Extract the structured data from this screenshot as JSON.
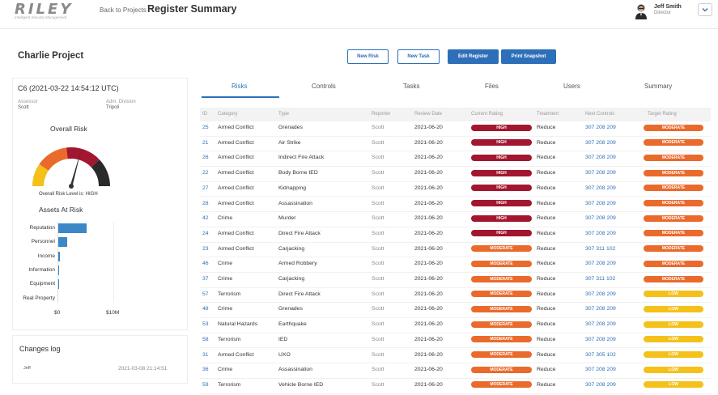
{
  "header": {
    "logo_text": "RILEY",
    "logo_sub": "Intelligent Security Management",
    "back_label": "Back to Projects",
    "title": "Register Summary",
    "user_name": "Jeff Smith",
    "user_role": "Director"
  },
  "project": {
    "name": "Charlie Project",
    "buttons": {
      "new_risk": "New Risk",
      "new_task": "New Task",
      "edit_register": "Edit Register",
      "print_snapshot": "Print Snapshot"
    }
  },
  "risk_panel": {
    "risk_id": "C6 (2021-03-22 14:54:12 UTC)",
    "assessor_label": "Assessor",
    "assessor_value": "Scott",
    "division_label": "Adm. Division",
    "division_value": "Tripoli",
    "overall_title": "Overall Risk",
    "overall_caption": "Overall Risk Level is: HIGH",
    "assets_title": "Assets At Risk",
    "assets": [
      {
        "label": "Reputation",
        "value": 0.52
      },
      {
        "label": "Personnel",
        "value": 0.16
      },
      {
        "label": "Income",
        "value": 0.03
      },
      {
        "label": "Information",
        "value": 0.02
      },
      {
        "label": "Equipment",
        "value": 0.02
      },
      {
        "label": "Real Property",
        "value": 0.0
      }
    ],
    "axis_ticks": [
      "$0",
      "$10M"
    ]
  },
  "changes": {
    "title": "Changes log",
    "user": "Jeff",
    "time": "2021-03-08 21:14:51"
  },
  "tabs": [
    "Risks",
    "Controls",
    "Tasks",
    "Files",
    "Users",
    "Summary"
  ],
  "table": {
    "headers": [
      "ID",
      "Category",
      "Type",
      "Reporter",
      "Review Date",
      "Current Rating",
      "Treatment",
      "Next Controls",
      "Target Rating"
    ],
    "rows": [
      {
        "id": "25",
        "category": "Armed Conflict",
        "type": "Grenades",
        "reporter": "Scott",
        "date": "2021-06-20",
        "current": "HIGH",
        "treatment": "Reduce",
        "controls": "307 208 209",
        "target": "MODERATE"
      },
      {
        "id": "21",
        "category": "Armed Conflict",
        "type": "Air Strike",
        "reporter": "Scott",
        "date": "2021-06-20",
        "current": "HIGH",
        "treatment": "Reduce",
        "controls": "307 208 209",
        "target": "MODERATE"
      },
      {
        "id": "26",
        "category": "Armed Conflict",
        "type": "Indirect Fire Attack",
        "reporter": "Scott",
        "date": "2021-06-20",
        "current": "HIGH",
        "treatment": "Reduce",
        "controls": "307 208 209",
        "target": "MODERATE"
      },
      {
        "id": "22",
        "category": "Armed Conflict",
        "type": "Body Borne IED",
        "reporter": "Scott",
        "date": "2021-06-20",
        "current": "HIGH",
        "treatment": "Reduce",
        "controls": "307 208 209",
        "target": "MODERATE"
      },
      {
        "id": "27",
        "category": "Armed Conflict",
        "type": "Kidnapping",
        "reporter": "Scott",
        "date": "2021-06-20",
        "current": "HIGH",
        "treatment": "Reduce",
        "controls": "307 208 209",
        "target": "MODERATE"
      },
      {
        "id": "28",
        "category": "Armed Conflict",
        "type": "Assassination",
        "reporter": "Scott",
        "date": "2021-06-20",
        "current": "HIGH",
        "treatment": "Reduce",
        "controls": "307 208 209",
        "target": "MODERATE"
      },
      {
        "id": "42",
        "category": "Crime",
        "type": "Murder",
        "reporter": "Scott",
        "date": "2021-06-20",
        "current": "HIGH",
        "treatment": "Reduce",
        "controls": "307 208 209",
        "target": "MODERATE"
      },
      {
        "id": "24",
        "category": "Armed Conflict",
        "type": "Direct Fire Attack",
        "reporter": "Scott",
        "date": "2021-06-20",
        "current": "HIGH",
        "treatment": "Reduce",
        "controls": "307 208 209",
        "target": "MODERATE"
      },
      {
        "id": "23",
        "category": "Armed Conflict",
        "type": "Carjacking",
        "reporter": "Scott",
        "date": "2021-06-20",
        "current": "MODERATE",
        "treatment": "Reduce",
        "controls": "307 311 102",
        "target": "MODERATE"
      },
      {
        "id": "46",
        "category": "Crime",
        "type": "Armed Robbery",
        "reporter": "Scott",
        "date": "2021-06-20",
        "current": "MODERATE",
        "treatment": "Reduce",
        "controls": "307 208 209",
        "target": "MODERATE"
      },
      {
        "id": "37",
        "category": "Crime",
        "type": "Carjacking",
        "reporter": "Scott",
        "date": "2021-06-20",
        "current": "MODERATE",
        "treatment": "Reduce",
        "controls": "307 311 102",
        "target": "MODERATE"
      },
      {
        "id": "57",
        "category": "Terrorism",
        "type": "Direct Fire Attack",
        "reporter": "Scott",
        "date": "2021-06-20",
        "current": "MODERATE",
        "treatment": "Reduce",
        "controls": "307 208 209",
        "target": "LOW"
      },
      {
        "id": "48",
        "category": "Crime",
        "type": "Grenades",
        "reporter": "Scott",
        "date": "2021-06-20",
        "current": "MODERATE",
        "treatment": "Reduce",
        "controls": "307 208 209",
        "target": "LOW"
      },
      {
        "id": "53",
        "category": "Natural Hazards",
        "type": "Earthquake",
        "reporter": "Scott",
        "date": "2021-06-20",
        "current": "MODERATE",
        "treatment": "Reduce",
        "controls": "307 208 209",
        "target": "LOW"
      },
      {
        "id": "58",
        "category": "Terrorism",
        "type": "IED",
        "reporter": "Scott",
        "date": "2021-06-20",
        "current": "MODERATE",
        "treatment": "Reduce",
        "controls": "307 208 209",
        "target": "LOW"
      },
      {
        "id": "31",
        "category": "Armed Conflict",
        "type": "UXO",
        "reporter": "Scott",
        "date": "2021-06-20",
        "current": "MODERATE",
        "treatment": "Reduce",
        "controls": "307 305 102",
        "target": "LOW"
      },
      {
        "id": "36",
        "category": "Crime",
        "type": "Assassination",
        "reporter": "Scott",
        "date": "2021-06-20",
        "current": "MODERATE",
        "treatment": "Reduce",
        "controls": "307 208 209",
        "target": "LOW"
      },
      {
        "id": "59",
        "category": "Terrorism",
        "type": "Vehicle Borne IED",
        "reporter": "Scott",
        "date": "2021-06-20",
        "current": "MODERATE",
        "treatment": "Reduce",
        "controls": "307 208 209",
        "target": "LOW"
      }
    ]
  },
  "colors": {
    "accent": "#2d6fb8",
    "high": "#a3162f",
    "moderate": "#ea6a2c",
    "low": "#f4c11a",
    "bar": "#3b87c7"
  }
}
